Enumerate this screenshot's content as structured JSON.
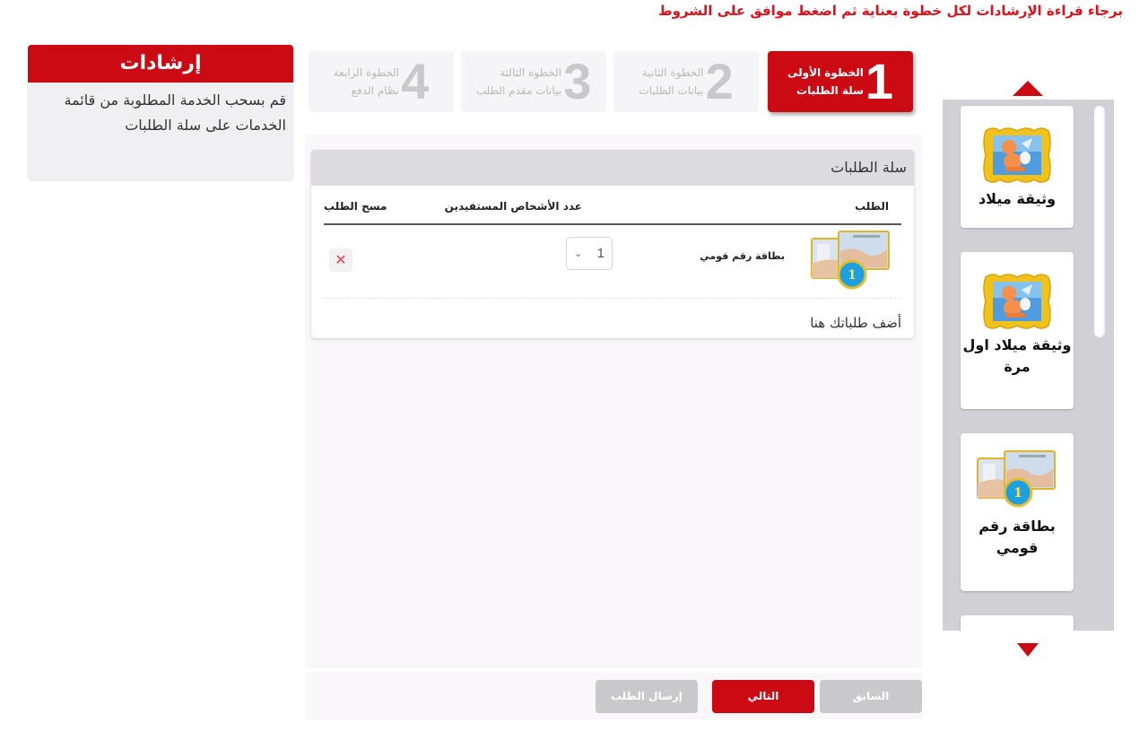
{
  "notice": "برجاء قراءة الإرشادات لكل خطوة بعناية ثم اضغط موافق على الشروط",
  "instructions": {
    "title": "إرشادات",
    "text": "قم بسحب الخدمة المطلوبة من قائمة الخدمات على سلة الطلبات"
  },
  "steps": [
    {
      "number": "1",
      "title": "الخطوة الأولى",
      "subtitle": "سلة الطلبات",
      "active": true
    },
    {
      "number": "2",
      "title": "الخطوة الثانية",
      "subtitle": "بيانات الطلبات",
      "active": false
    },
    {
      "number": "3",
      "title": "الخطوة الثالثة",
      "subtitle": "بيانات مقدم الطلب",
      "active": false
    },
    {
      "number": "4",
      "title": "الخطوة الرابعة",
      "subtitle": "نظام الدفع",
      "active": false
    }
  ],
  "basket": {
    "title": "سلة الطلبات",
    "columns": {
      "request": "الطلب",
      "beneficiaries": "عدد الأشخاص المستفيدين",
      "delete": "مسح الطلب"
    },
    "rows": [
      {
        "name": "بطاقة رقم قومي",
        "icon": "national-id-card-icon",
        "badge": "1",
        "quantity": "1"
      }
    ],
    "drop_hint": "أضف طلباتك هنا"
  },
  "buttons": {
    "previous": "السابق",
    "next": "التالي",
    "send": "إرسال الطلب"
  },
  "services": [
    {
      "name": "وثيقة ميلاد",
      "icon": "birth-certificate-icon"
    },
    {
      "name": "وثيقة ميلاد اول مرة",
      "icon": "birth-certificate-icon"
    },
    {
      "name": "بطاقة رقم قومي",
      "icon": "national-id-card-icon",
      "badge": "1"
    }
  ],
  "colors": {
    "accent": "#cc0a14",
    "notice": "#e0101a",
    "disabled": "#c9c8cb",
    "panel": "#d1d0d4"
  }
}
